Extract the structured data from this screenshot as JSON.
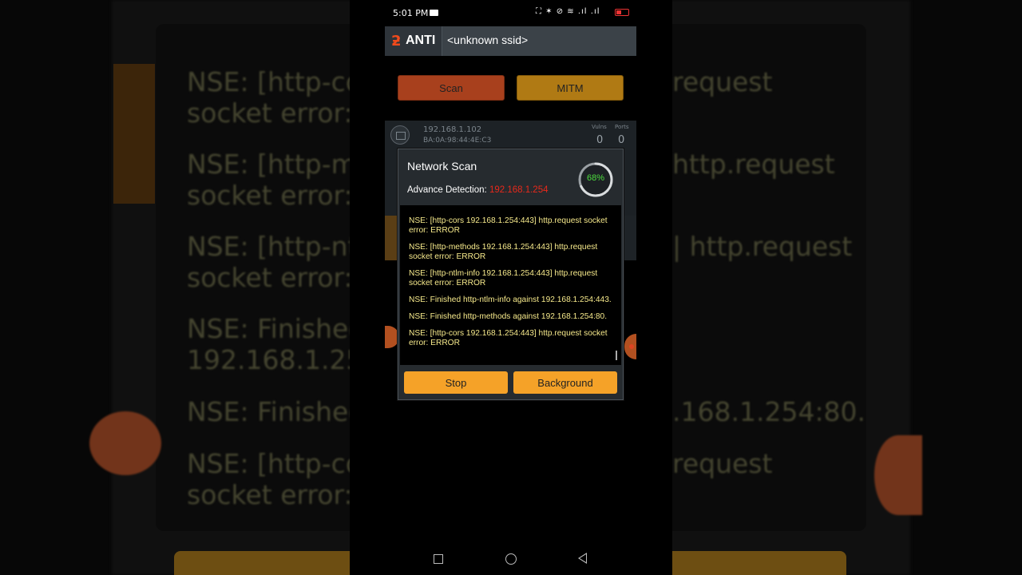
{
  "status": {
    "time": "5:01 PM",
    "icons": "⛶ ✶ ⊘ ≋ .ıl .ıl"
  },
  "app": {
    "logo_text": "ANTI",
    "ssid": "<unknown ssid>"
  },
  "buttons": {
    "scan": "Scan",
    "mitm": "MITM"
  },
  "device": {
    "ip": "192.168.1.102",
    "mac": "BA:0A:98:44:4E:C3",
    "vulns_label": "Vulns",
    "ports_label": "Ports",
    "vulns": "0",
    "ports": "0"
  },
  "dialog": {
    "title": "Network Scan",
    "detection_label": "Advance Detection:",
    "detection_ip": "192.168.1.254",
    "progress_text": "68%",
    "progress_value": 0.68,
    "stop": "Stop",
    "background": "Background",
    "log": [
      "NSE: [http-cors 192.168.1.254:443] http.request socket error: ERROR",
      "NSE: [http-methods 192.168.1.254:443] http.request socket error: ERROR",
      "NSE: [http-ntlm-info 192.168.1.254:443] http.request socket error: ERROR",
      "NSE: Finished http-ntlm-info against 192.168.1.254:443.",
      "NSE: Finished http-methods against 192.168.1.254:80.",
      "NSE: [http-cors 192.168.1.254:443] http.request socket error: ERROR"
    ]
  },
  "colors": {
    "accent": "#f5a228",
    "scan_button": "#a8401d",
    "mitm_button": "#b07a14",
    "progress": "#4ddf3e",
    "detection_ip": "#e8291b",
    "log_text": "#f6e98b"
  }
}
